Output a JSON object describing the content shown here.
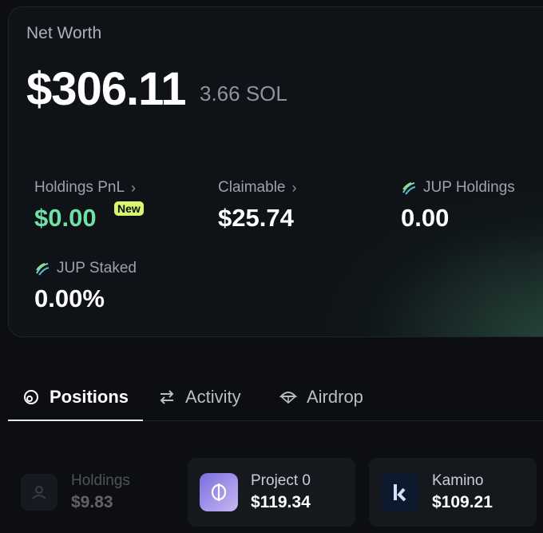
{
  "summary": {
    "title": "Net Worth",
    "value": "$306.11",
    "sol": "3.66 SOL"
  },
  "stats": {
    "holdings_pnl": {
      "label": "Holdings PnL",
      "value": "$0.00",
      "badge": "New"
    },
    "claimable": {
      "label": "Claimable",
      "value": "$25.74"
    },
    "jup_holdings": {
      "label": "JUP Holdings",
      "value": "0.00"
    },
    "jup_staked": {
      "label": "JUP Staked",
      "value": "0.00%"
    }
  },
  "tabs": [
    {
      "label": "Positions",
      "icon": "positions-icon",
      "active": true
    },
    {
      "label": "Activity",
      "icon": "swap-arrows-icon",
      "active": false
    },
    {
      "label": "Airdrop",
      "icon": "parachute-icon",
      "active": false
    }
  ],
  "positions": [
    {
      "name": "Holdings",
      "value": "$9.83",
      "icon": "user-icon"
    },
    {
      "name": "Project 0",
      "value": "$119.34",
      "icon": "project0-logo"
    },
    {
      "name": "Kamino",
      "value": "$109.21",
      "icon": "kamino-logo"
    }
  ],
  "colors": {
    "accent_green": "#6fe0a6",
    "badge": "#d6f76e",
    "background": "#0c0e12"
  }
}
